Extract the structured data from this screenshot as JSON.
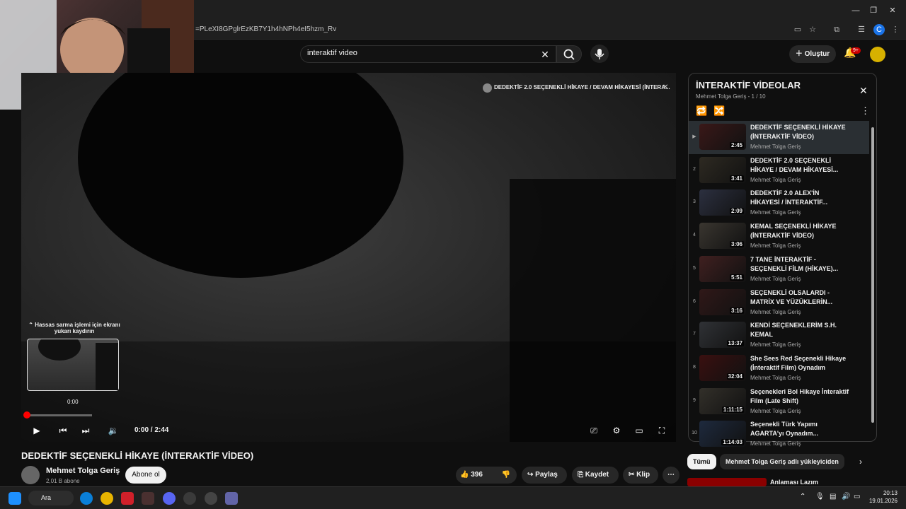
{
  "browser": {
    "url_fragment": "=PLeXI8GPglrEzKB7Y1h4hNPh4eI5hzm_Rv",
    "window_controls": [
      "—",
      "❐",
      "✕"
    ]
  },
  "header": {
    "search_value": "interaktif video",
    "create_label": "Oluştur",
    "notif_count": "9+"
  },
  "player": {
    "overlay_title": "DEDEKTİF 2.0 SEÇENEKLİ HİKAYE / DEVAM HİKAYESİ (İNTERA...",
    "seek_hint_line1": "⌃ Hassas sarma işlemi için ekranı",
    "seek_hint_line2": "yukarı kaydırın",
    "seek_time": "0:00",
    "time_display": "0:00 / 2:44",
    "progress_fraction": 0.0
  },
  "video": {
    "title": "DEDEKTİF SEÇENEKLİ HİKAYE (İNTERAKTİF VİDEO)",
    "channel": "Mehmet Tolga Geriş",
    "subscribers": "2,01 B abone",
    "subscribe_label": "Abone ol",
    "likes": "396",
    "share_label": "Paylaş",
    "save_label": "Kaydet",
    "clip_label": "Klip"
  },
  "playlist": {
    "title": "İNTERAKTİF VİDEOLAR",
    "subtitle": "Mehmet Tolga Geriş - 1 / 10",
    "items": [
      {
        "idx": "▶",
        "title": "DEDEKTİF SEÇENEKLİ HİKAYE (İNTERAKTİF VİDEO)",
        "channel": "Mehmet Tolga Geriş",
        "duration": "2:45",
        "color": "#3a1818"
      },
      {
        "idx": "2",
        "title": "DEDEKTİF 2.0 SEÇENEKLİ HİKAYE / DEVAM HİKAYESİ...",
        "channel": "Mehmet Tolga Geriş",
        "duration": "3:41",
        "color": "#2e2a22"
      },
      {
        "idx": "3",
        "title": "DEDEKTİF 2.0 ALEX'İN HİKAYESİ / İNTERAKTİF...",
        "channel": "Mehmet Tolga Geriş",
        "duration": "2:09",
        "color": "#2c3040"
      },
      {
        "idx": "4",
        "title": "KEMAL SEÇENEKLİ HİKAYE (İNTERAKTİF VİDEO)",
        "channel": "Mehmet Tolga Geriş",
        "duration": "3:06",
        "color": "#3a3630"
      },
      {
        "idx": "5",
        "title": "7 TANE İNTERAKTİF - SEÇENEKLİ FİLM (HİKAYE)...",
        "channel": "Mehmet Tolga Geriş",
        "duration": "5:51",
        "color": "#402020"
      },
      {
        "idx": "6",
        "title": "SEÇENEKLİ OLSALARDI - MATRİX VE YÜZÜKLERİN...",
        "channel": "Mehmet Tolga Geriş",
        "duration": "3:16",
        "color": "#301818"
      },
      {
        "idx": "7",
        "title": "KENDİ SEÇENEKLERİM S.H. KEMAL",
        "channel": "Mehmet Tolga Geriş",
        "duration": "13:37",
        "color": "#303236"
      },
      {
        "idx": "8",
        "title": "She Sees Red Seçenekli Hikaye (İnteraktif Film) Oynadım",
        "channel": "Mehmet Tolga Geriş",
        "duration": "32:04",
        "color": "#3a1010"
      },
      {
        "idx": "9",
        "title": "Seçenekleri Bol Hikaye İnteraktif Film (Late Shift)",
        "channel": "Mehmet Tolga Geriş",
        "duration": "1:11:15",
        "color": "#33302a"
      },
      {
        "idx": "10",
        "title": "Seçenekli Türk Yapımı AGARTA'yı Oynadım...",
        "channel": "Mehmet Tolga Geriş",
        "duration": "1:14:03",
        "color": "#1e2a3e"
      }
    ]
  },
  "chips": {
    "all": "Tümü",
    "uploader": "Mehmet Tolga Geriş adlı yükleyiciden"
  },
  "recommendation": {
    "title": "Anlaması Lazım"
  },
  "taskbar": {
    "search_label": "Ara",
    "time": "20:13",
    "date": "19.01.2026"
  }
}
